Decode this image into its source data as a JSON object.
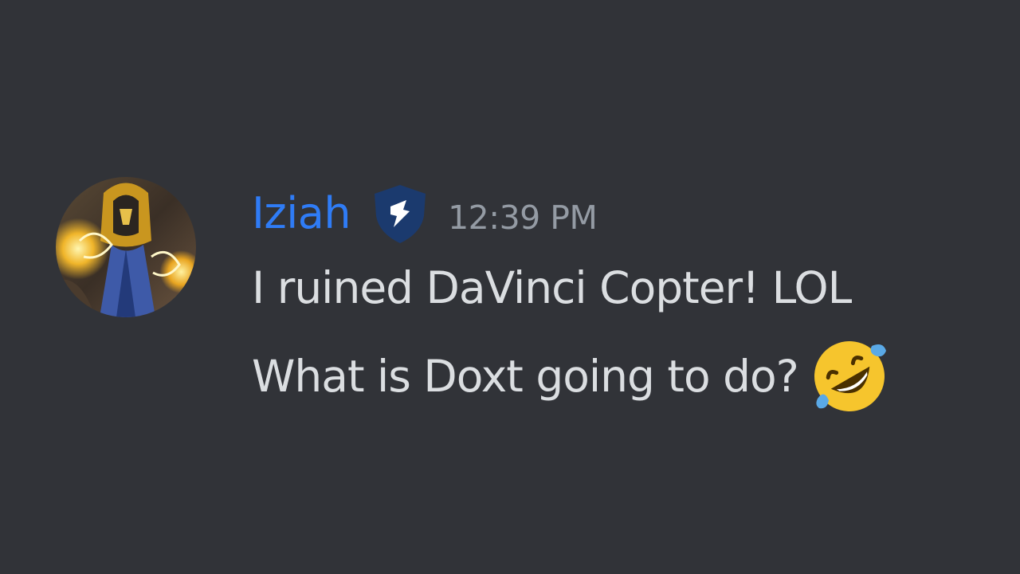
{
  "message": {
    "author": "Iziah",
    "timestamp": "12:39 PM",
    "lines": [
      "I ruined DaVinci Copter! LOL",
      "What is Doxt going to do?"
    ],
    "avatar_icon": "user-avatar",
    "badge_icon": "shield-badge-icon",
    "emoji_icon": "rolling-on-floor-laughing-emoji"
  },
  "colors": {
    "background": "#313338",
    "username": "#2f7cf6",
    "timestamp": "#949ba4",
    "text": "#dbdee1",
    "badge": "#1b3a6e"
  }
}
